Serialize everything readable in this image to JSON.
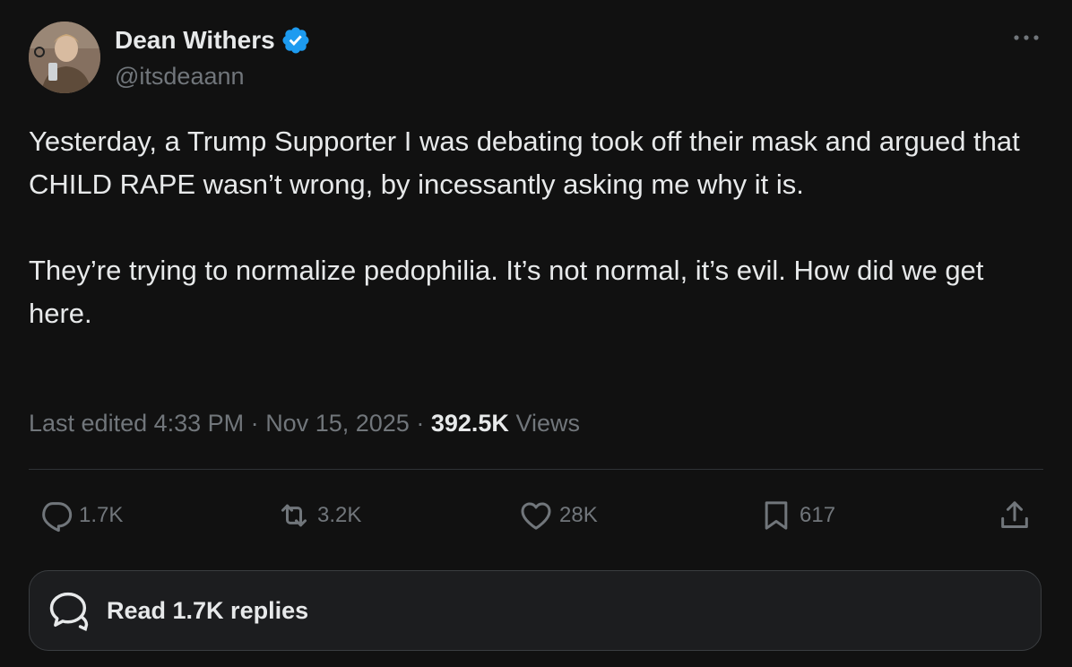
{
  "author": {
    "display_name": "Dean Withers",
    "handle": "@itsdeaann",
    "verified": true,
    "verified_color": "#1d9bf0"
  },
  "tweet": {
    "paragraphs": [
      "Yesterday, a Trump Supporter I was debating took off their mask and argued that CHILD RAPE wasn’t wrong, by incessantly asking me why it is.",
      "They’re trying to normalize pedophilia. It’s not normal, it’s evil. How did we get here."
    ]
  },
  "meta": {
    "edited_prefix": "Last edited 4:33 PM",
    "separator": "·",
    "date": "Nov 15, 2025",
    "views_count": "392.5K",
    "views_label": "Views"
  },
  "actions": {
    "replies": {
      "icon": "reply-icon",
      "count": "1.7K"
    },
    "reposts": {
      "icon": "repost-icon",
      "count": "3.2K"
    },
    "likes": {
      "icon": "heart-icon",
      "count": "28K"
    },
    "bookmarks": {
      "icon": "bookmark-icon",
      "count": "617"
    },
    "share": {
      "icon": "share-icon"
    }
  },
  "read_replies": {
    "icon": "chat-bubble-icon",
    "label": "Read 1.7K replies"
  },
  "menu": {
    "icon": "more-options-icon"
  },
  "colors": {
    "background": "#111111",
    "text": "#e7e9ea",
    "muted": "#71767b",
    "divider": "#2f3336"
  }
}
